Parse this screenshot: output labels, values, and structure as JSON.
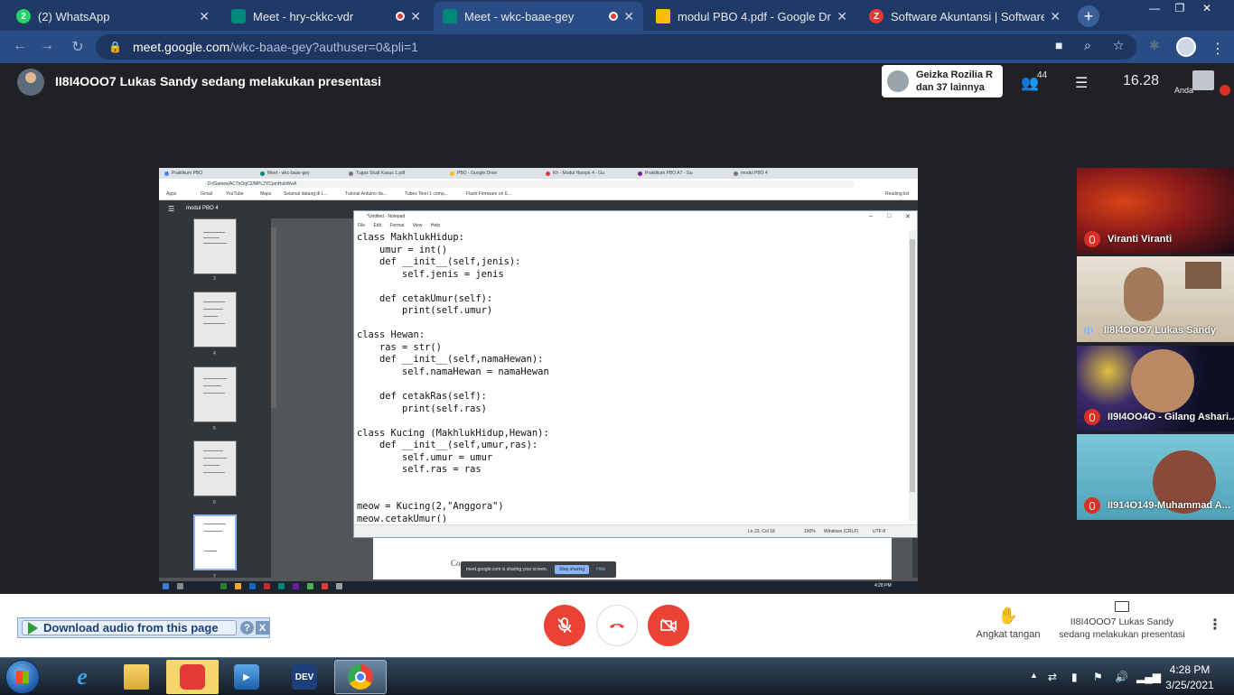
{
  "browser": {
    "tabs": [
      {
        "title": "(2) WhatsApp",
        "icon": "whatsapp-icon",
        "color": "#25d366",
        "badge": "2"
      },
      {
        "title": "Meet - hry-ckkc-vdr",
        "icon": "meet-icon",
        "color": "#00897b"
      },
      {
        "title": "Meet - wkc-baae-gey",
        "icon": "meet-icon",
        "color": "#00897b"
      },
      {
        "title": "modul PBO 4.pdf - Google Drive",
        "icon": "drive-icon",
        "color": "#fbbc04"
      },
      {
        "title": "Software Akuntansi | Software Ja",
        "icon": "zahir-icon",
        "color": "#e53935",
        "badge": "Z"
      }
    ],
    "url_host": "meet.google.com",
    "url_path": "/wkc-baae-gey?authuser=0&pli=1"
  },
  "meet": {
    "presenter_text": "II8I4OOO7 Lukas Sandy sedang melakukan presentasi",
    "others_line1": "Geizka Rozilia R",
    "others_line2": "dan 37 lainnya",
    "participants_count": "44",
    "time": "16.28",
    "self_label": "Anda"
  },
  "shared_screen": {
    "browser_tabs": [
      "Praktikum PBO",
      "Meet - wkc-baae-gey",
      "Tugas Studi Kasus 1.pdf",
      "PBO - Google Drive",
      "Kh - Modul Hampir 4 - Gu",
      "Praktikum PBO A7 - Gu",
      "modul PBO 4"
    ],
    "url": "D:/Games/AC7nOqC2/MPL2YCpmHokWwA",
    "bookmarks": [
      "Apps",
      "Gmail",
      "YouTube",
      "Maps",
      "Selamat datang di L...",
      "Tutorial Arduino da...",
      "Tubes Teori 1 comp...",
      "Flash Firmware on E...",
      "Reading list"
    ],
    "pdf_title": "modul PBO 4",
    "thumb_numbers": [
      "3",
      "4",
      "5",
      "6",
      "7"
    ],
    "notepad": {
      "title": "*Untitled - Notepad",
      "menu": [
        "File",
        "Edit",
        "Format",
        "View",
        "Help"
      ],
      "code": "class MakhlukHidup:\n    umur = int()\n    def __init__(self,jenis):\n        self.jenis = jenis\n\n    def cetakUmur(self):\n        print(self.umur)\n\nclass Hewan:\n    ras = str()\n    def __init__(self,namaHewan):\n        self.namaHewan = namaHewan\n\n    def cetakRas(self):\n        print(self.ras)\n\nclass Kucing (MakhlukHidup,Hewan):\n    def __init__(self,umur,ras):\n        self.umur = umur\n        self.ras = ras\n\n\nmeow = Kucing(2,\"Anggora\")\nmeow.cetakUmur()",
      "status_pos": "Ln 23, Col 18",
      "status_zoom": "100%",
      "status_eol": "Windows (CRLF)",
      "status_enc": "UTF-8"
    },
    "page_text": "Co",
    "share_text": "meet.google.com is sharing your screen.",
    "stop_label": "Stop sharing",
    "hide_label": "Hide",
    "taskbar_time": "4:28 PM"
  },
  "tiles": [
    {
      "name": "Viranti Viranti",
      "status": "muted",
      "bg": "#8b1a1a"
    },
    {
      "name": "II8I4OOO7 Lukas Sandy",
      "status": "speaking",
      "bg": "#cfc4b2"
    },
    {
      "name": "II9I4OO4O - Gilang Ashari...",
      "status": "muted",
      "bg": "#1a1e3a"
    },
    {
      "name": "II914O149-Muhammad A...",
      "status": "muted",
      "bg": "#5bb3c9"
    }
  ],
  "bottom": {
    "download_label": "Download audio from this page",
    "help_label": "?",
    "close_label": "X",
    "raise_label": "Angkat tangan",
    "present_line1": "II8I4OOO7 Lukas Sandy",
    "present_line2": "sedang melakukan presentasi"
  },
  "taskbar": {
    "time": "4:28 PM",
    "date": "3/25/2021",
    "apps": [
      "internet-explorer-icon",
      "windows-explorer-icon",
      "screen-recorder-icon",
      "media-player-icon",
      "dev-cpp-icon",
      "chrome-icon"
    ]
  }
}
